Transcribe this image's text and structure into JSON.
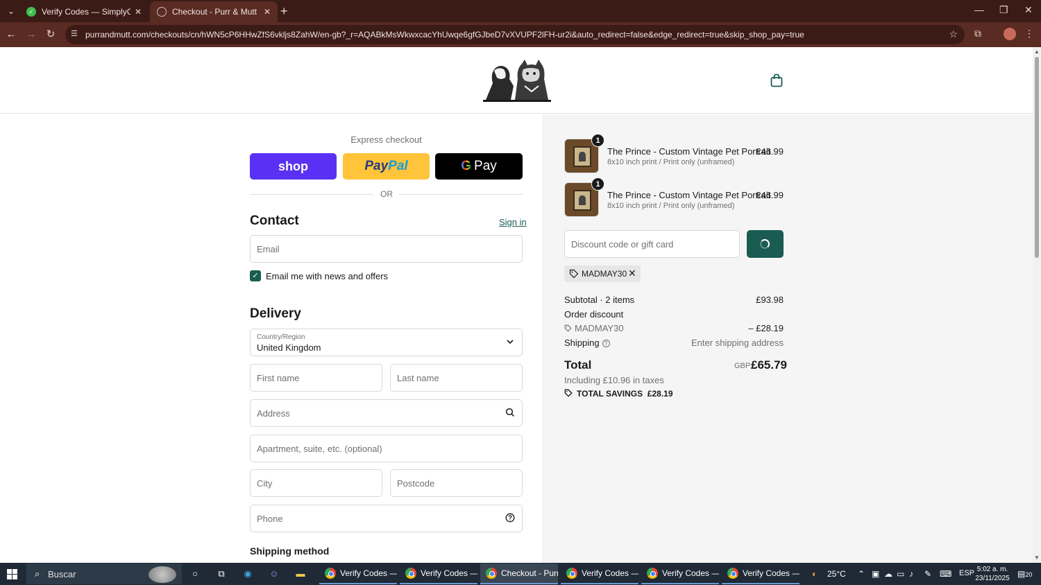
{
  "browser": {
    "tabs": [
      {
        "title": "Verify Codes — SimplyCodes",
        "active": false
      },
      {
        "title": "Checkout - Purr & Mutt",
        "active": true
      }
    ],
    "url": "purrandmutt.com/checkouts/cn/hWN5cP6HHwZfS6vkljs8ZahW/en-gb?_r=AQABkMsWkwxcacYhUwqe6gfGJbeD7vXVUPF2lFH-ur2i&auto_redirect=false&edge_redirect=true&skip_shop_pay=true"
  },
  "checkout": {
    "express_title": "Express checkout",
    "shop_label": "shop",
    "paypal_pay": "Pay",
    "paypal_pal": "Pal",
    "gpay_g": "G",
    "gpay_label": "Pay",
    "or_label": "OR",
    "contact_title": "Contact",
    "sign_in": "Sign in",
    "email_placeholder": "Email",
    "newsletter_label": "Email me with news and offers",
    "newsletter_checked": true,
    "delivery_title": "Delivery",
    "country_label": "Country/Region",
    "country_value": "United Kingdom",
    "first_name_placeholder": "First name",
    "last_name_placeholder": "Last name",
    "address_placeholder": "Address",
    "apartment_placeholder": "Apartment, suite, etc. (optional)",
    "city_placeholder": "City",
    "postcode_placeholder": "Postcode",
    "phone_placeholder": "Phone",
    "shipping_method_title": "Shipping method"
  },
  "summary": {
    "items": [
      {
        "qty": "1",
        "name": "The Prince - Custom Vintage Pet Portrait",
        "variant": "8x10 inch print / Print only (unframed)",
        "price": "£46.99"
      },
      {
        "qty": "1",
        "name": "The Prince - Custom Vintage Pet Portrait",
        "variant": "8x10 inch print / Print only (unframed)",
        "price": "£46.99"
      }
    ],
    "discount_placeholder": "Discount code or gift card",
    "applied_code": "MADMAY30",
    "subtotal_label": "Subtotal · 2 items",
    "subtotal_value": "£93.98",
    "order_discount_label": "Order discount",
    "discount_code": "MADMAY30",
    "discount_value": "– £28.19",
    "shipping_label": "Shipping",
    "shipping_value": "Enter shipping address",
    "total_label": "Total",
    "total_currency": "GBP",
    "total_value": "£65.79",
    "taxes_note": "Including £10.96 in taxes",
    "savings_label": "TOTAL SAVINGS",
    "savings_value": "£28.19"
  },
  "taskbar": {
    "search_label": "Buscar",
    "apps": [
      {
        "label": "Verify Codes — S...",
        "active": false
      },
      {
        "label": "Verify Codes — S...",
        "active": false
      },
      {
        "label": "Checkout - Purr ...",
        "active": true
      },
      {
        "label": "Verify Codes — S...",
        "active": false
      },
      {
        "label": "Verify Codes — S...",
        "active": false
      },
      {
        "label": "Verify Codes — S...",
        "active": false
      }
    ],
    "temperature": "25°C",
    "language": "ESP",
    "time": "5:02 a. m.",
    "date": "23/11/2025",
    "notification_count": "20"
  },
  "colors": {
    "accent": "#1a5c52",
    "shop_pay": "#5a31f4",
    "paypal": "#ffc439",
    "chrome_frame": "#3b1b16"
  }
}
